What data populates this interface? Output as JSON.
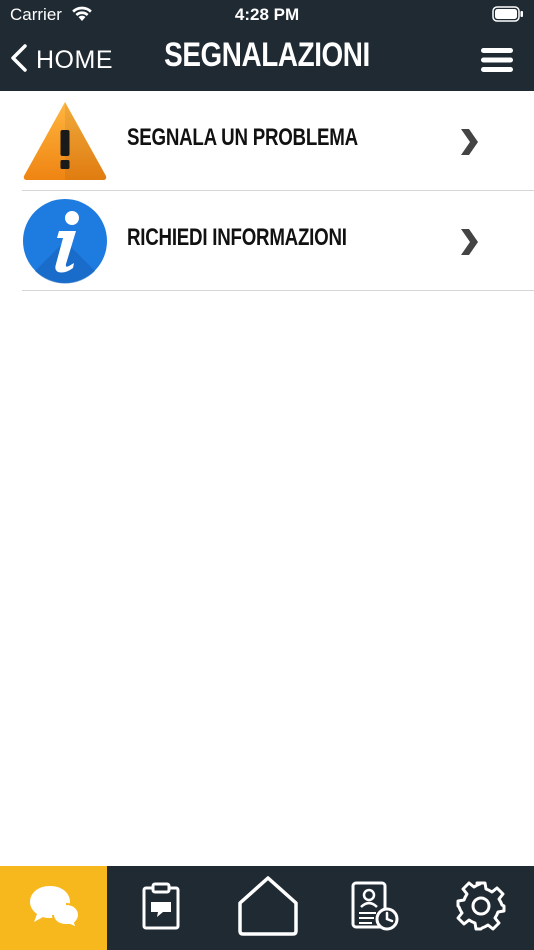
{
  "status_bar": {
    "carrier": "Carrier",
    "time": "4:28 PM"
  },
  "nav": {
    "back_label": "HOME",
    "title": "SEGNALAZIONI"
  },
  "list": {
    "items": [
      {
        "label": "SEGNALA UN PROBLEMA",
        "icon": "warning-icon"
      },
      {
        "label": "RICHIEDI INFORMAZIONI",
        "icon": "info-icon"
      }
    ]
  },
  "tabbar": {
    "tabs": [
      {
        "icon": "chat-bubbles-icon",
        "active": true
      },
      {
        "icon": "clipboard-report-icon",
        "active": false
      },
      {
        "icon": "home-icon",
        "active": false
      },
      {
        "icon": "contact-schedule-icon",
        "active": false
      },
      {
        "icon": "gear-icon",
        "active": false
      }
    ]
  },
  "colors": {
    "bar": "#1f2a32",
    "accent": "#f7b81e",
    "warning": "#f39a1e",
    "info": "#1e7be0"
  }
}
